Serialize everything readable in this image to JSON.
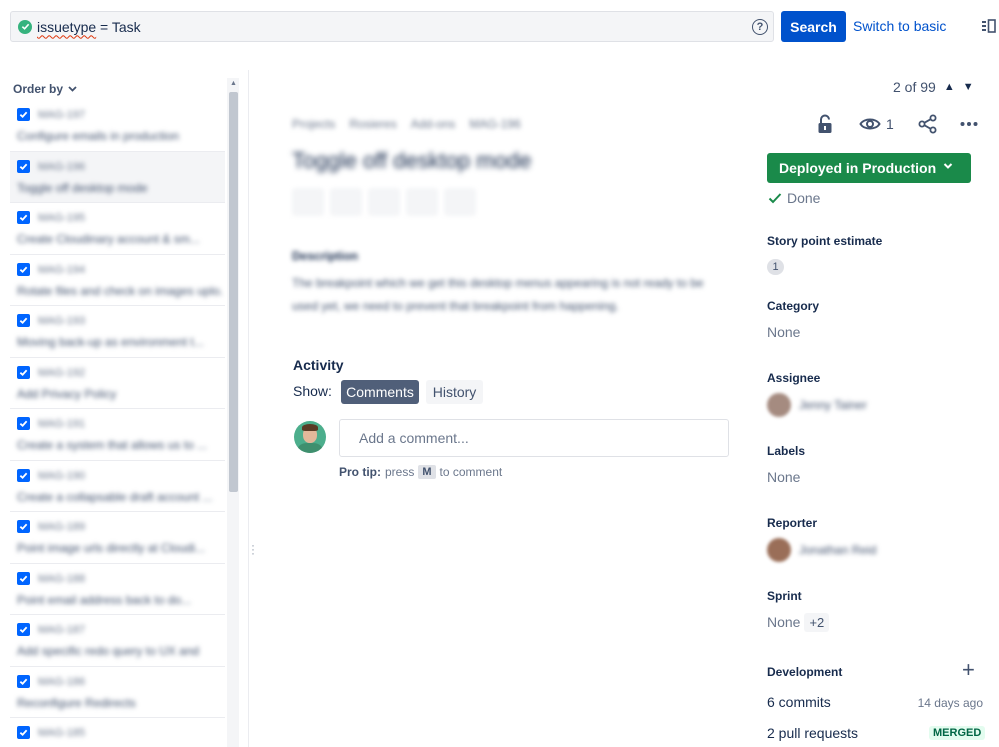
{
  "search": {
    "jql_keyword": "issuetype",
    "jql_rest": " = Task",
    "help_glyph": "?",
    "button_label": "Search",
    "switch_label": "Switch to basic"
  },
  "list": {
    "order_by_label": "Order by",
    "items": [
      {
        "key": "MAG-197",
        "summary": "Configure emails in production",
        "selected": false
      },
      {
        "key": "MAG-196",
        "summary": "Toggle off desktop mode",
        "selected": true
      },
      {
        "key": "MAG-195",
        "summary": "Create Cloudinary account & sm...",
        "selected": false
      },
      {
        "key": "MAG-194",
        "summary": "Rotate files and check on images uplo...",
        "selected": false
      },
      {
        "key": "MAG-193",
        "summary": "Moving back-up as environment t...",
        "selected": false
      },
      {
        "key": "MAG-192",
        "summary": "Add Privacy Policy",
        "selected": false
      },
      {
        "key": "MAG-191",
        "summary": "Create a system that allows us to ...",
        "selected": false
      },
      {
        "key": "MAG-190",
        "summary": "Create a collapsable draft account ...",
        "selected": false
      },
      {
        "key": "MAG-189",
        "summary": "Point image urls directly at Cloudi...",
        "selected": false
      },
      {
        "key": "MAG-188",
        "summary": "Point email address back to do...",
        "selected": false
      },
      {
        "key": "MAG-187",
        "summary": "Add specific redo query to UX and",
        "selected": false
      },
      {
        "key": "MAG-186",
        "summary": "Reconfigure Redirects",
        "selected": false
      },
      {
        "key": "MAG-185",
        "summary": "",
        "selected": false
      }
    ]
  },
  "pager": {
    "text": "2 of 99"
  },
  "issue": {
    "breadcrumb": [
      "Projects",
      "Rosieres",
      "Add-ons",
      "MAG-196"
    ],
    "title": "Toggle off desktop mode",
    "description_label": "Description",
    "description": "The breakpoint which we get this desktop menus appearing is not ready to be used yet, we need to prevent that breakpoint from happening."
  },
  "activity": {
    "label": "Activity",
    "show_label": "Show:",
    "tabs": [
      "Comments",
      "History"
    ],
    "comment_placeholder": "Add a comment...",
    "protip_bold": "Pro tip:",
    "protip_press": "press",
    "protip_key": "M",
    "protip_rest": "to comment"
  },
  "sidebar": {
    "watch_count": "1",
    "status": "Deployed in Production",
    "resolution": "Done",
    "story_point_label": "Story point estimate",
    "story_point_value": "1",
    "category_label": "Category",
    "category_value": "None",
    "assignee_label": "Assignee",
    "assignee_name": "Jenny Tainer",
    "labels_label": "Labels",
    "labels_value": "None",
    "reporter_label": "Reporter",
    "reporter_name": "Jonathan Reid",
    "sprint_label": "Sprint",
    "sprint_value": "None",
    "sprint_extra": "+2",
    "development_label": "Development",
    "commits": "6 commits",
    "commits_time": "14 days ago",
    "pull_requests": "2 pull requests",
    "pr_status": "MERGED"
  },
  "colors": {
    "primary": "#0052cc",
    "status_green": "#1a8a4a",
    "active_tab": "#505f79"
  }
}
